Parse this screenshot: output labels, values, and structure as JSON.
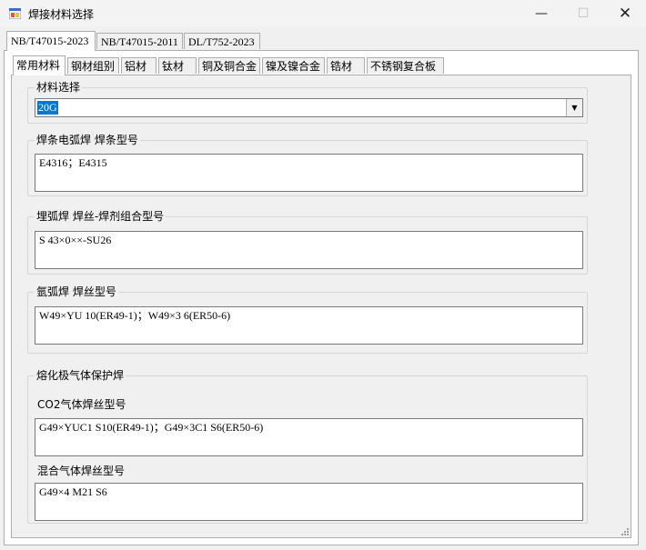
{
  "window": {
    "title": "焊接材料选择"
  },
  "outer_tabs": [
    "NB/T47015-2023",
    "NB/T47015-2011",
    "DL/T752-2023"
  ],
  "inner_tabs": [
    "常用材料",
    "钢材组别",
    "铝材",
    "钛材",
    "铜及铜合金",
    "镍及镍合金",
    "锆材",
    "不锈钢复合板"
  ],
  "material": {
    "label": "材料选择",
    "selected": "20G"
  },
  "smaw": {
    "label": "焊条电弧焊  焊条型号",
    "value": "E4316；E4315"
  },
  "saw": {
    "label": "埋弧焊  焊丝-焊剂组合型号",
    "value": "S 43×0××-SU26"
  },
  "gtaw": {
    "label": "氩弧焊  焊丝型号",
    "value": "W49×YU 10(ER49-1)；W49×3 6(ER50-6)"
  },
  "gmaw": {
    "label": "熔化极气体保护焊",
    "co2_label": "CO2气体焊丝型号",
    "co2_value": "G49×YUC1 S10(ER49-1)；G49×3C1 S6(ER50-6)",
    "mixed_label": "混合气体焊丝型号",
    "mixed_value": "G49×4 M21 S6"
  }
}
